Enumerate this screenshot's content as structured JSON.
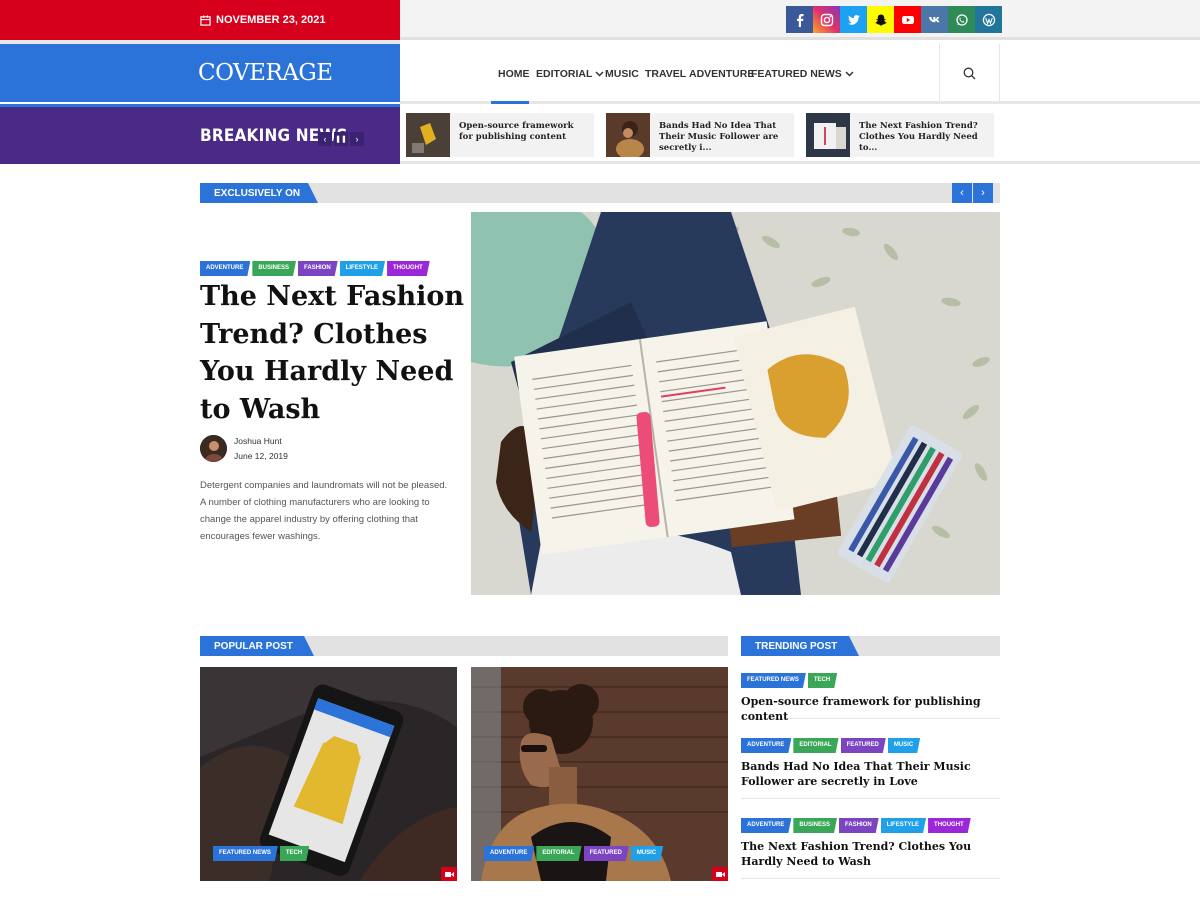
{
  "topbar": {
    "date": "NOVEMBER 23, 2021"
  },
  "social": [
    {
      "name": "facebook-icon",
      "color": "#3b5998"
    },
    {
      "name": "instagram-icon",
      "color": "#c13584"
    },
    {
      "name": "twitter-icon",
      "color": "#1da1f2"
    },
    {
      "name": "snapchat-icon",
      "color": "#fffc00"
    },
    {
      "name": "youtube-icon",
      "color": "#ff0000"
    },
    {
      "name": "vk-icon",
      "color": "#4a76a8"
    },
    {
      "name": "whatsapp-icon",
      "color": "#2e8b57"
    },
    {
      "name": "wordpress-icon",
      "color": "#21759b"
    }
  ],
  "brand": {
    "logo": "COVERAGE",
    "accent": "#2c73d9",
    "red": "#d6001c",
    "purple": "#4a2a86"
  },
  "nav": {
    "items": [
      "HOME",
      "EDITORIAL",
      "MUSIC",
      "TRAVEL",
      "ADVENTURE",
      "FEATURED NEWS"
    ]
  },
  "breaking": {
    "label": "BREAKING NEWS",
    "items": [
      "Open-source framework for publishing content",
      "Bands Had No Idea That Their Music Follower are secretly i...",
      "The Next Fashion Trend? Clothes You Hardly Need to..."
    ]
  },
  "exclusive": {
    "label": "EXCLUSIVELY ON",
    "tags": [
      "ADVENTURE",
      "BUSINESS",
      "FASHION",
      "LIFESTYLE",
      "THOUGHT"
    ],
    "title": "The Next Fashion Trend? Clothes You Hardly Need to Wash",
    "author": "Joshua Hunt",
    "date": "June 12, 2019",
    "excerpt": "Detergent companies and laundromats will not be pleased. A number of clothing manufacturers who are looking to change the apparel industry by offering clothing that encourages fewer washings."
  },
  "popular": {
    "label": "POPULAR POST",
    "cards": [
      {
        "tags": [
          "FEATURED NEWS",
          "TECH"
        ]
      },
      {
        "tags": [
          "ADVENTURE",
          "EDITORIAL",
          "FEATURED",
          "MUSIC"
        ]
      }
    ]
  },
  "trending": {
    "label": "TRENDING POST",
    "items": [
      {
        "tags": [
          "FEATURED NEWS",
          "TECH"
        ],
        "title": "Open-source framework for publishing content"
      },
      {
        "tags": [
          "ADVENTURE",
          "EDITORIAL",
          "FEATURED",
          "MUSIC"
        ],
        "title": "Bands Had No Idea That Their Music Follower are secretly in Love"
      },
      {
        "tags": [
          "ADVENTURE",
          "BUSINESS",
          "FASHION",
          "LIFESTYLE",
          "THOUGHT"
        ],
        "title": "The Next Fashion Trend? Clothes You Hardly Need to Wash"
      }
    ]
  },
  "tag_colors": {
    "ADVENTURE": "#2c73d9",
    "BUSINESS": "#3aa657",
    "FASHION": "#7b45c1",
    "LIFESTYLE": "#1fa0e8",
    "THOUGHT": "#9c27d8",
    "FEATURED NEWS": "#2c73d9",
    "TECH": "#3aa657",
    "EDITORIAL": "#3aa657",
    "FEATURED": "#7b45c1",
    "MUSIC": "#1fa0e8"
  }
}
